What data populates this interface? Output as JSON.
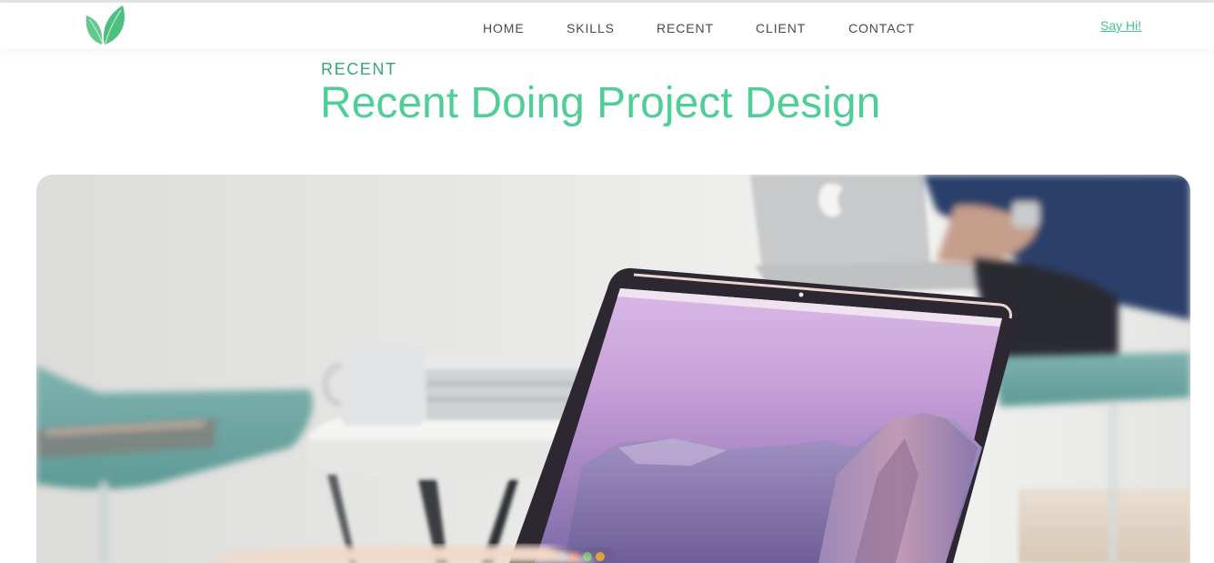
{
  "nav": {
    "logo_name": "leaf-logo-icon",
    "items": [
      {
        "label": "HOME"
      },
      {
        "label": "SKILLS"
      },
      {
        "label": "RECENT"
      },
      {
        "label": "CLIENT"
      },
      {
        "label": "CONTACT"
      }
    ],
    "cta_label": "Say Hi!"
  },
  "section": {
    "eyebrow": "RECENT",
    "title": "Recent Doing Project Design"
  },
  "colors": {
    "accent": "#4fcf96",
    "accent_dark": "#34a877",
    "nav_text": "#4a4a4a"
  }
}
